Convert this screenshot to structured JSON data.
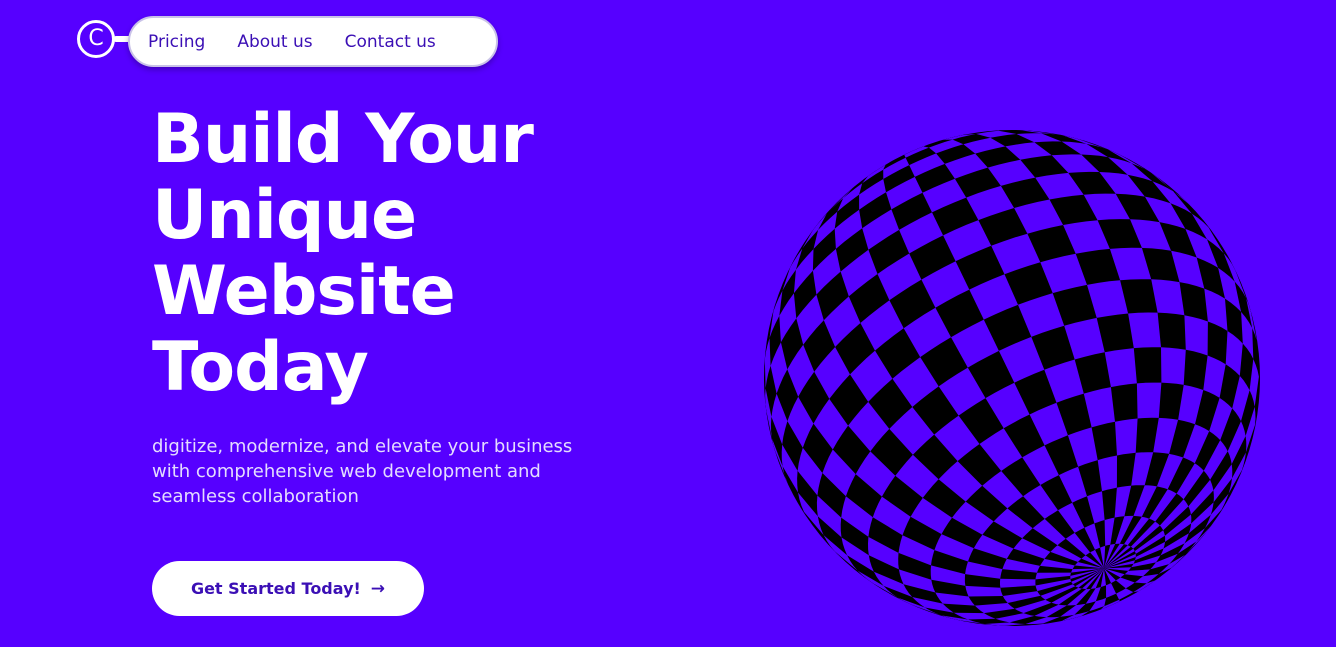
{
  "colors": {
    "background": "#5600FF",
    "nav_bg": "#FFFFFF",
    "nav_text": "#3B0FB5",
    "headline": "#FFFFFF",
    "subtext": "#E4DCFF",
    "sphere_pattern": "#000000"
  },
  "logo": {
    "letter": "C",
    "icon": "c-circle-logo-icon"
  },
  "nav": {
    "items": [
      {
        "label": "Pricing"
      },
      {
        "label": "About us"
      },
      {
        "label": "Contact us"
      }
    ]
  },
  "hero": {
    "title_lines": [
      "Build Your",
      "Unique",
      "Website",
      "Today"
    ],
    "subtitle": "digitize, modernize, and elevate your business with comprehensive web development and seamless collaboration",
    "cta_label": "Get Started Today!",
    "cta_icon": "arrow-right-icon",
    "cta_arrow": "→"
  },
  "sphere": {
    "icon": "checkered-sphere-graphic"
  }
}
